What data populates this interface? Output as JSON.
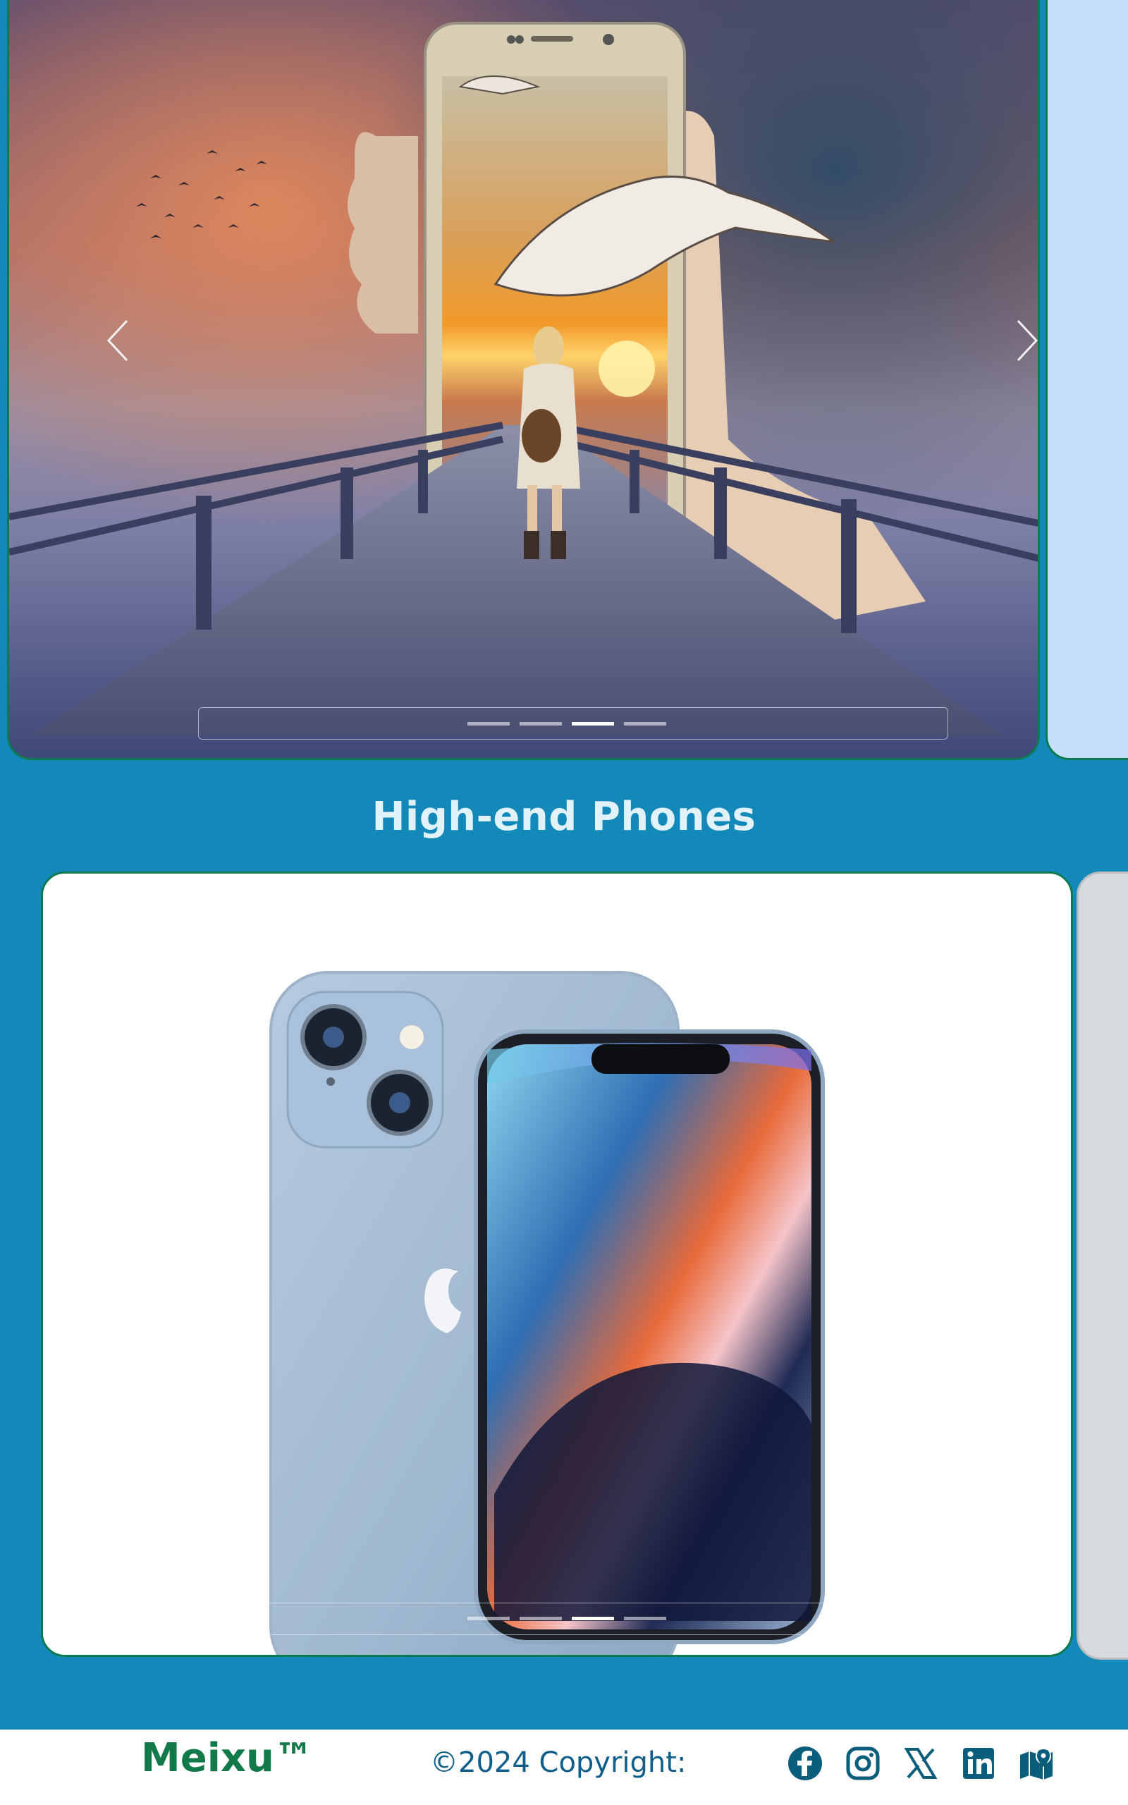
{
  "hero_carousel": {
    "image_alt": "Surreal hand holding a phone with a girl with a guitar walking down a pier into the sunset",
    "prev_label": "‹",
    "next_label": "›",
    "slide_count": 4,
    "active_slide": 3
  },
  "section": {
    "title": "High-end Phones"
  },
  "product_carousel": {
    "image_alt": "Blue smartphone front and back",
    "slide_count": 4,
    "active_slide": 3
  },
  "footer": {
    "brand": "Meixu™",
    "copyright": "©2024 Copyright:",
    "social": [
      "facebook-icon",
      "instagram-icon",
      "x-icon",
      "linkedin-icon",
      "map-icon"
    ]
  },
  "colors": {
    "page_bg": "#1289b8",
    "card_border": "#0e7a52",
    "brand_green": "#127a48",
    "footer_text": "#0f5f8a",
    "icon_color": "#0b5d7c"
  }
}
